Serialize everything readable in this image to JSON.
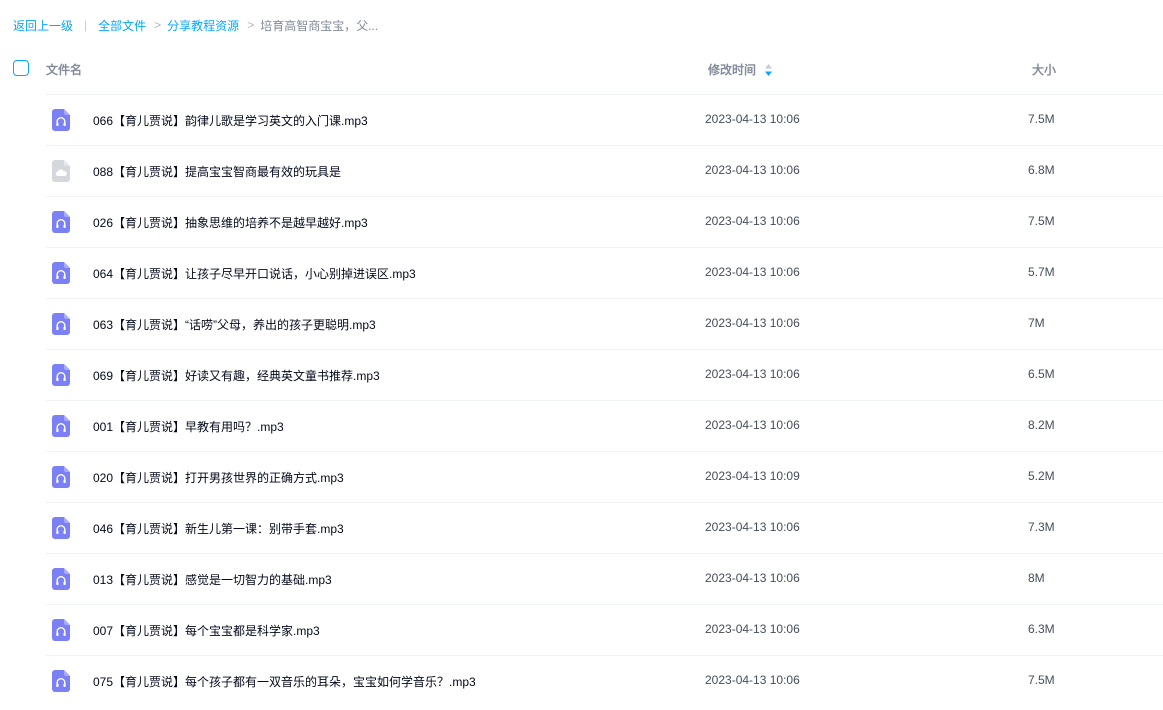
{
  "breadcrumb": {
    "back": "返回上一级",
    "all_files": "全部文件",
    "share_folder": "分享教程资源",
    "current": "培育高智商宝宝，父..."
  },
  "columns": {
    "name": "文件名",
    "modified": "修改时间",
    "size": "大小"
  },
  "colors": {
    "accent": "#06a7ff",
    "audio_icon": "#7b80f5",
    "unknown_icon": "#d4d7dc"
  },
  "files": [
    {
      "icon": "audio-file-icon",
      "name": "066【育儿贾说】韵律儿歌是学习英文的入门课.mp3",
      "time": "2023-04-13 10:06",
      "size": "7.5M"
    },
    {
      "icon": "cloud-file-icon",
      "name": "088【育儿贾说】提高宝宝智商最有效的玩具是",
      "time": "2023-04-13 10:06",
      "size": "6.8M"
    },
    {
      "icon": "audio-file-icon",
      "name": "026【育儿贾说】抽象思维的培养不是越早越好.mp3",
      "time": "2023-04-13 10:06",
      "size": "7.5M"
    },
    {
      "icon": "audio-file-icon",
      "name": "064【育儿贾说】让孩子尽早开口说话，小心别掉进误区.mp3",
      "time": "2023-04-13 10:06",
      "size": "5.7M"
    },
    {
      "icon": "audio-file-icon",
      "name": "063【育儿贾说】“话唠”父母，养出的孩子更聪明.mp3",
      "time": "2023-04-13 10:06",
      "size": "7M"
    },
    {
      "icon": "audio-file-icon",
      "name": "069【育儿贾说】好读又有趣，经典英文童书推荐.mp3",
      "time": "2023-04-13 10:06",
      "size": "6.5M"
    },
    {
      "icon": "audio-file-icon",
      "name": "001【育儿贾说】早教有用吗？.mp3",
      "time": "2023-04-13 10:06",
      "size": "8.2M"
    },
    {
      "icon": "audio-file-icon",
      "name": "020【育儿贾说】打开男孩世界的正确方式.mp3",
      "time": "2023-04-13 10:09",
      "size": "5.2M"
    },
    {
      "icon": "audio-file-icon",
      "name": "046【育儿贾说】新生儿第一课：别带手套.mp3",
      "time": "2023-04-13 10:06",
      "size": "7.3M"
    },
    {
      "icon": "audio-file-icon",
      "name": "013【育儿贾说】感觉是一切智力的基础.mp3",
      "time": "2023-04-13 10:06",
      "size": "8M"
    },
    {
      "icon": "audio-file-icon",
      "name": "007【育儿贾说】每个宝宝都是科学家.mp3",
      "time": "2023-04-13 10:06",
      "size": "6.3M"
    },
    {
      "icon": "audio-file-icon",
      "name": "075【育儿贾说】每个孩子都有一双音乐的耳朵，宝宝如何学音乐？.mp3",
      "time": "2023-04-13 10:06",
      "size": "7.5M"
    }
  ]
}
